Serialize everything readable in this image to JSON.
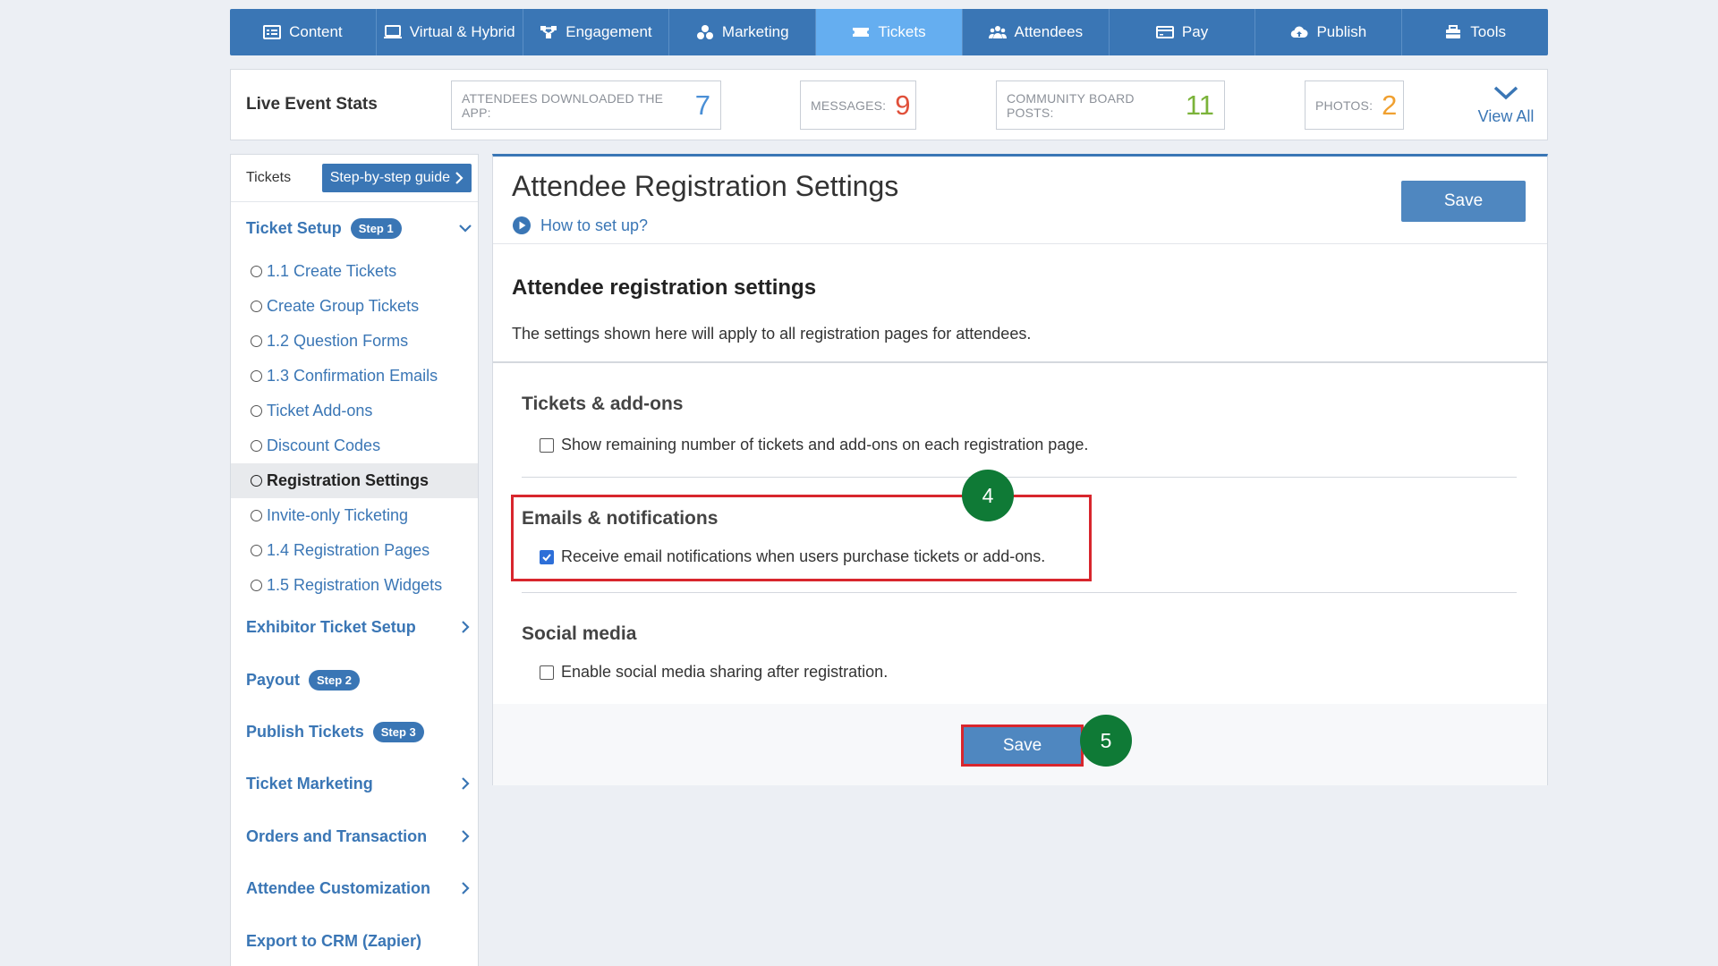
{
  "topnav": {
    "items": [
      {
        "label": "Content",
        "icon": "content-icon"
      },
      {
        "label": "Virtual & Hybrid",
        "icon": "monitor-icon"
      },
      {
        "label": "Engagement",
        "icon": "network-icon"
      },
      {
        "label": "Marketing",
        "icon": "marketing-icon"
      },
      {
        "label": "Tickets",
        "icon": "ticket-icon",
        "active": true
      },
      {
        "label": "Attendees",
        "icon": "people-icon"
      },
      {
        "label": "Pay",
        "icon": "card-icon"
      },
      {
        "label": "Publish",
        "icon": "cloud-upload-icon"
      },
      {
        "label": "Tools",
        "icon": "toolbox-icon"
      }
    ]
  },
  "stats": {
    "title": "Live Event Stats",
    "items": [
      {
        "label": "ATTENDEES DOWNLOADED THE APP:",
        "value": "7",
        "color": "#4a8fd6"
      },
      {
        "label": "MESSAGES:",
        "value": "9",
        "color": "#e0503a"
      },
      {
        "label": "COMMUNITY BOARD POSTS:",
        "value": "11",
        "color": "#7bb33a"
      },
      {
        "label": "PHOTOS:",
        "value": "2",
        "color": "#f0a030"
      }
    ],
    "view_all": "View All"
  },
  "sidebar": {
    "header_label": "Tickets",
    "guide_button": "Step-by-step guide",
    "ticket_setup": {
      "title": "Ticket Setup",
      "step": "Step 1",
      "items": [
        "1.1 Create Tickets",
        "Create Group Tickets",
        "1.2 Question Forms",
        "1.3 Confirmation Emails",
        "Ticket Add-ons",
        "Discount Codes",
        "Registration Settings",
        "Invite-only Ticketing",
        "1.4 Registration Pages",
        "1.5 Registration Widgets"
      ],
      "active_index": 6
    },
    "exhibitor": "Exhibitor Ticket Setup",
    "payout": {
      "title": "Payout",
      "step": "Step 2"
    },
    "publish": {
      "title": "Publish Tickets",
      "step": "Step 3"
    },
    "ticket_marketing": "Ticket Marketing",
    "orders": "Orders and Transaction",
    "attendee_customization": "Attendee Customization",
    "export_crm": "Export to CRM (Zapier)"
  },
  "main": {
    "page_title": "Attendee Registration Settings",
    "howto": "How to set up?",
    "save_top": "Save",
    "section_title": "Attendee registration settings",
    "section_desc": "The settings shown here will apply to all registration pages for attendees.",
    "groups": {
      "tickets": {
        "title": "Tickets & add-ons",
        "option": "Show remaining number of tickets and add-ons on each registration page.",
        "checked": false
      },
      "emails": {
        "title": "Emails & notifications",
        "option": "Receive email notifications when users purchase tickets or add-ons.",
        "checked": true
      },
      "social": {
        "title": "Social media",
        "option": "Enable social media sharing after registration.",
        "checked": false
      }
    },
    "save_bottom": "Save"
  },
  "annotations": {
    "badge_emails": "4",
    "badge_save": "5"
  }
}
